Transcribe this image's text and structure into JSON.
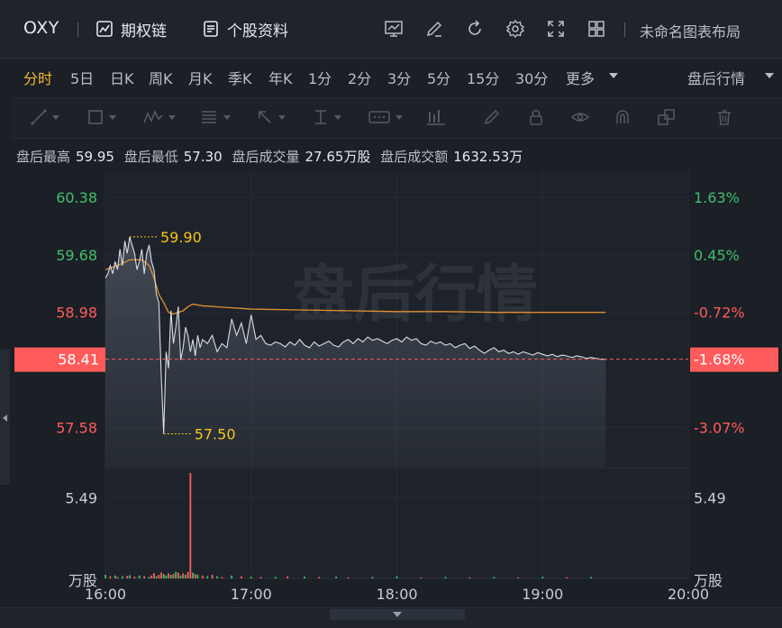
{
  "header": {
    "symbol": "OXY",
    "options_chain": "期权链",
    "stock_profile": "个股资料",
    "layout_name": "未命名图表布局"
  },
  "icons": [
    "options-chain-icon",
    "stock-profile-icon",
    "indicator-icon",
    "draw-icon",
    "refresh-icon",
    "settings-icon",
    "fullscreen-icon",
    "layout-grid-icon"
  ],
  "periods": [
    "分时",
    "5日",
    "日K",
    "周K",
    "月K",
    "季K",
    "年K",
    "1分",
    "2分",
    "3分",
    "5分",
    "15分",
    "30分",
    "更多"
  ],
  "active_period": "分时",
  "session": "盘后行情",
  "info": {
    "high_label": "盘后最高",
    "high_value": "59.95",
    "low_label": "盘后最低",
    "low_value": "57.30",
    "volume_label": "盘后成交量",
    "volume_value": "27.65万股",
    "turnover_label": "盘后成交额",
    "turnover_value": "1632.53万"
  },
  "colors": {
    "up": "#3fbf6b",
    "down": "#ff5b5b",
    "price_line": "#d9dde3",
    "avg_line": "#e0902f",
    "annotation": "#f5c518",
    "grid": "#262b33"
  },
  "chart_data": {
    "type": "line",
    "watermark": "盘后行情",
    "x_ticks": [
      "16:00",
      "17:00",
      "18:00",
      "19:00",
      "20:00"
    ],
    "x_range": [
      0,
      240
    ],
    "price_ticks": [
      "60.38",
      "59.68",
      "58.98",
      "57.58"
    ],
    "pct_ticks": [
      "1.63%",
      "0.45%",
      "-0.72%",
      "-3.07%"
    ],
    "price_range": [
      57.1,
      60.7
    ],
    "current_price": "58.41",
    "current_pct": "-1.68%",
    "max_label": "59.90",
    "max_point": [
      10,
      59.9
    ],
    "min_label": "57.50",
    "min_point": [
      24,
      57.5
    ],
    "volume_tick": "5.49",
    "volume_unit": "万股",
    "volume_max": 7.5,
    "price": [
      [
        0,
        59.4
      ],
      [
        1,
        59.45
      ],
      [
        2,
        59.55
      ],
      [
        3,
        59.45
      ],
      [
        4,
        59.6
      ],
      [
        5,
        59.5
      ],
      [
        6,
        59.75
      ],
      [
        7,
        59.55
      ],
      [
        8,
        59.85
      ],
      [
        9,
        59.7
      ],
      [
        10,
        59.9
      ],
      [
        11,
        59.8
      ],
      [
        12,
        59.7
      ],
      [
        13,
        59.5
      ],
      [
        14,
        59.6
      ],
      [
        15,
        59.75
      ],
      [
        16,
        59.45
      ],
      [
        17,
        59.7
      ],
      [
        18,
        59.8
      ],
      [
        19,
        59.6
      ],
      [
        20,
        59.5
      ],
      [
        21,
        59.2
      ],
      [
        22,
        59.1
      ],
      [
        23,
        58.2
      ],
      [
        24,
        57.5
      ],
      [
        25,
        58.5
      ],
      [
        26,
        58.3
      ],
      [
        27,
        59.0
      ],
      [
        28,
        58.6
      ],
      [
        29,
        58.8
      ],
      [
        30,
        59.05
      ],
      [
        31,
        58.4
      ],
      [
        32,
        58.55
      ],
      [
        33,
        58.8
      ],
      [
        34,
        58.7
      ],
      [
        35,
        58.5
      ],
      [
        36,
        58.65
      ],
      [
        37,
        58.45
      ],
      [
        38,
        58.7
      ],
      [
        39,
        58.55
      ],
      [
        40,
        58.65
      ],
      [
        42,
        58.6
      ],
      [
        44,
        58.7
      ],
      [
        46,
        58.5
      ],
      [
        48,
        58.6
      ],
      [
        50,
        58.55
      ],
      [
        52,
        58.9
      ],
      [
        54,
        58.7
      ],
      [
        56,
        58.85
      ],
      [
        58,
        58.6
      ],
      [
        60,
        58.95
      ],
      [
        62,
        58.65
      ],
      [
        64,
        58.7
      ],
      [
        66,
        58.6
      ],
      [
        68,
        58.58
      ],
      [
        70,
        58.62
      ],
      [
        72,
        58.6
      ],
      [
        74,
        58.56
      ],
      [
        76,
        58.62
      ],
      [
        78,
        58.58
      ],
      [
        80,
        58.65
      ],
      [
        82,
        58.58
      ],
      [
        84,
        58.55
      ],
      [
        86,
        58.62
      ],
      [
        88,
        58.57
      ],
      [
        90,
        58.6
      ],
      [
        92,
        58.63
      ],
      [
        94,
        58.58
      ],
      [
        96,
        58.56
      ],
      [
        98,
        58.62
      ],
      [
        100,
        58.65
      ],
      [
        102,
        58.6
      ],
      [
        104,
        58.66
      ],
      [
        106,
        58.62
      ],
      [
        108,
        58.68
      ],
      [
        110,
        58.64
      ],
      [
        112,
        58.66
      ],
      [
        114,
        58.63
      ],
      [
        116,
        58.6
      ],
      [
        118,
        58.64
      ],
      [
        120,
        58.66
      ],
      [
        122,
        58.62
      ],
      [
        124,
        58.68
      ],
      [
        126,
        58.64
      ],
      [
        128,
        58.66
      ],
      [
        130,
        58.6
      ],
      [
        132,
        58.58
      ],
      [
        134,
        58.63
      ],
      [
        136,
        58.6
      ],
      [
        138,
        58.62
      ],
      [
        140,
        58.58
      ],
      [
        142,
        58.6
      ],
      [
        144,
        58.55
      ],
      [
        146,
        58.58
      ],
      [
        148,
        58.6
      ],
      [
        150,
        58.54
      ],
      [
        152,
        58.57
      ],
      [
        154,
        58.52
      ],
      [
        156,
        58.48
      ],
      [
        158,
        58.52
      ],
      [
        160,
        58.55
      ],
      [
        162,
        58.5
      ],
      [
        164,
        58.52
      ],
      [
        166,
        58.48
      ],
      [
        168,
        58.5
      ],
      [
        170,
        58.47
      ],
      [
        172,
        58.5
      ],
      [
        174,
        58.48
      ],
      [
        176,
        58.46
      ],
      [
        178,
        58.49
      ],
      [
        180,
        58.47
      ],
      [
        182,
        58.45
      ],
      [
        184,
        58.47
      ],
      [
        186,
        58.44
      ],
      [
        188,
        58.46
      ],
      [
        190,
        58.45
      ],
      [
        192,
        58.43
      ],
      [
        194,
        58.45
      ],
      [
        196,
        58.44
      ],
      [
        198,
        58.42
      ],
      [
        200,
        58.43
      ],
      [
        202,
        58.42
      ],
      [
        204,
        58.41
      ],
      [
        206,
        58.41
      ]
    ],
    "avg_price": [
      [
        0,
        59.5
      ],
      [
        5,
        59.55
      ],
      [
        10,
        59.62
      ],
      [
        15,
        59.62
      ],
      [
        18,
        59.55
      ],
      [
        20,
        59.4
      ],
      [
        22,
        59.2
      ],
      [
        24,
        59.1
      ],
      [
        26,
        58.98
      ],
      [
        28,
        58.96
      ],
      [
        30,
        58.98
      ],
      [
        32,
        59.0
      ],
      [
        34,
        59.05
      ],
      [
        36,
        59.08
      ],
      [
        40,
        59.06
      ],
      [
        50,
        59.04
      ],
      [
        60,
        59.02
      ],
      [
        80,
        59.01
      ],
      [
        100,
        59.0
      ],
      [
        120,
        58.99
      ],
      [
        140,
        58.99
      ],
      [
        160,
        58.98
      ],
      [
        180,
        58.98
      ],
      [
        206,
        58.98
      ]
    ],
    "volume": [
      [
        0,
        0.25,
        "up"
      ],
      [
        2,
        0.15,
        "down"
      ],
      [
        4,
        0.2,
        "up"
      ],
      [
        5,
        0.1,
        "down"
      ],
      [
        7,
        0.15,
        "up"
      ],
      [
        9,
        0.18,
        "down"
      ],
      [
        10,
        0.22,
        "up"
      ],
      [
        12,
        0.12,
        "down"
      ],
      [
        14,
        0.2,
        "up"
      ],
      [
        16,
        0.15,
        "down"
      ],
      [
        18,
        0.1,
        "up"
      ],
      [
        19,
        0.2,
        "down"
      ],
      [
        20,
        0.35,
        "down"
      ],
      [
        21,
        0.15,
        "up"
      ],
      [
        22,
        0.25,
        "down"
      ],
      [
        23,
        0.4,
        "down"
      ],
      [
        24,
        0.3,
        "up"
      ],
      [
        25,
        0.2,
        "up"
      ],
      [
        26,
        0.35,
        "down"
      ],
      [
        27,
        0.25,
        "up"
      ],
      [
        28,
        0.3,
        "down"
      ],
      [
        29,
        0.45,
        "up"
      ],
      [
        30,
        0.4,
        "down"
      ],
      [
        31,
        0.2,
        "up"
      ],
      [
        32,
        0.35,
        "down"
      ],
      [
        33,
        0.25,
        "up"
      ],
      [
        34,
        0.45,
        "down"
      ],
      [
        35,
        7.2,
        "down"
      ],
      [
        36,
        0.4,
        "up"
      ],
      [
        37,
        0.3,
        "down"
      ],
      [
        38,
        0.25,
        "up"
      ],
      [
        40,
        0.2,
        "down"
      ],
      [
        42,
        0.15,
        "up"
      ],
      [
        44,
        0.25,
        "down"
      ],
      [
        46,
        0.15,
        "up"
      ],
      [
        48,
        0.1,
        "down"
      ],
      [
        52,
        0.2,
        "up"
      ],
      [
        56,
        0.15,
        "down"
      ],
      [
        60,
        0.12,
        "up"
      ],
      [
        64,
        0.1,
        "down"
      ],
      [
        70,
        0.1,
        "up"
      ],
      [
        75,
        0.15,
        "down"
      ],
      [
        82,
        0.12,
        "up"
      ],
      [
        88,
        0.1,
        "down"
      ],
      [
        95,
        0.12,
        "up"
      ],
      [
        100,
        0.08,
        "down"
      ],
      [
        110,
        0.1,
        "up"
      ],
      [
        120,
        0.15,
        "up"
      ],
      [
        130,
        0.08,
        "down"
      ],
      [
        140,
        0.1,
        "up"
      ],
      [
        150,
        0.08,
        "down"
      ],
      [
        160,
        0.1,
        "up"
      ],
      [
        170,
        0.08,
        "down"
      ],
      [
        180,
        0.12,
        "up"
      ],
      [
        190,
        0.08,
        "down"
      ],
      [
        200,
        0.1,
        "up"
      ]
    ]
  }
}
